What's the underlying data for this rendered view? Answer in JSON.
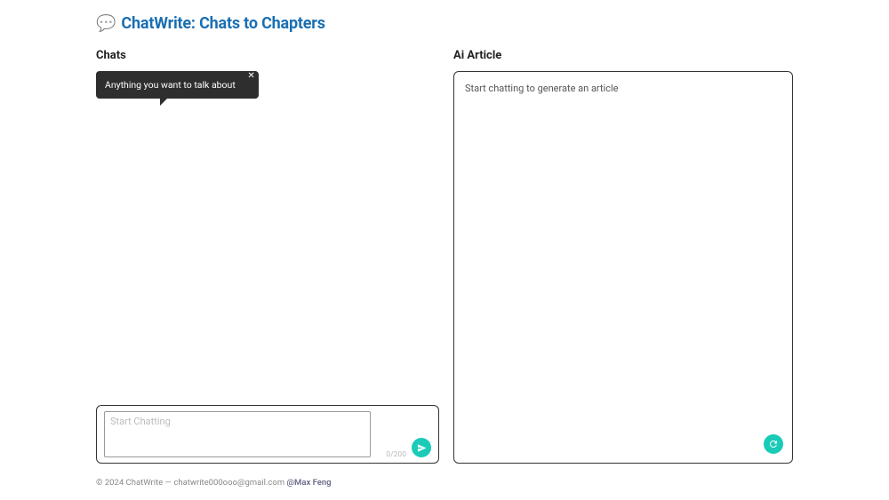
{
  "header": {
    "icon": "💬",
    "title": "ChatWrite: Chats to Chapters"
  },
  "chats": {
    "section_label": "Chats",
    "tooltip_text": "Anything you want to talk about",
    "tooltip_close": "✕",
    "input_placeholder": "Start Chatting",
    "char_count": "0/200"
  },
  "article": {
    "section_label": "Ai Article",
    "placeholder_text": "Start chatting to generate an article"
  },
  "footer": {
    "copyright": "© 2024 ChatWrite — ",
    "email": "chatwrite000ooo@gmail.com",
    "separator": "  ",
    "author": "@Max Feng"
  }
}
